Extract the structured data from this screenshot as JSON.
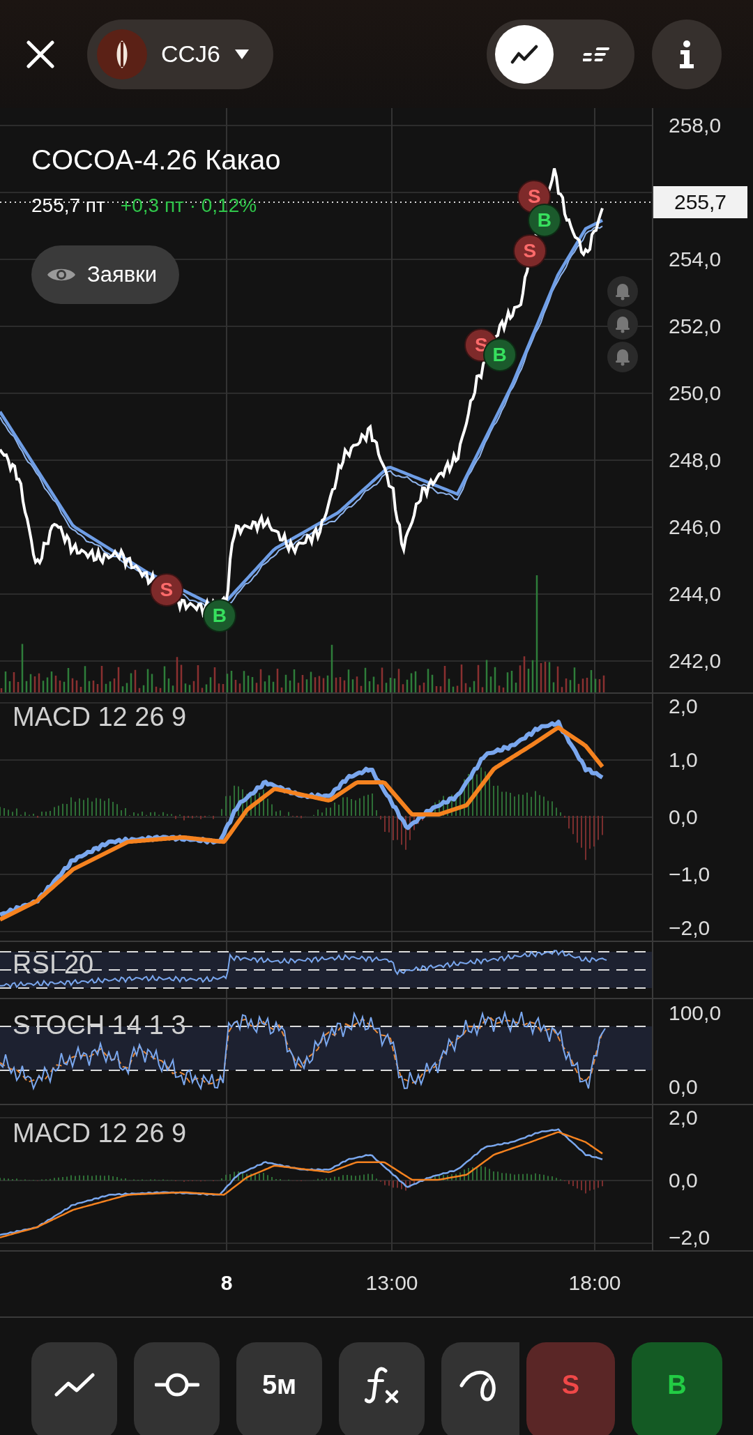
{
  "ticker": {
    "symbol": "CCJ6"
  },
  "view_toggle": [
    {
      "kind": "line",
      "selected": true
    },
    {
      "kind": "orders",
      "selected": false
    }
  ],
  "instrument": {
    "title": "COCOA-4.26 Какао",
    "price": "255,7 пт",
    "change": "+0,3 пт · 0,12%"
  },
  "orders_button": {
    "label": "Заявки"
  },
  "price_axis": [
    "258,0",
    "254,0",
    "252,0",
    "250,0",
    "248,0",
    "246,0",
    "244,0",
    "242,0"
  ],
  "current_price_tag": "255,7",
  "markers": [
    {
      "kind": "sell",
      "label": "S"
    },
    {
      "kind": "buy",
      "label": "B"
    },
    {
      "kind": "sell",
      "label": "S"
    },
    {
      "kind": "buy",
      "label": "B"
    },
    {
      "kind": "sell",
      "label": "S"
    },
    {
      "kind": "sell",
      "label": "S"
    },
    {
      "kind": "buy",
      "label": "B"
    }
  ],
  "panels": [
    {
      "kind": "macd",
      "label": "MACD 12 26 9",
      "ticks": [
        "2,0",
        "1,0",
        "0,0",
        "−1,0",
        "−2,0"
      ]
    },
    {
      "kind": "rsi",
      "label": "RSI 20"
    },
    {
      "kind": "stoch",
      "label": "STOCH 14 1 3",
      "ticks": [
        "100,0",
        "0,0"
      ]
    },
    {
      "kind": "macd_small",
      "label": "MACD 12 26 9",
      "ticks": [
        "2,0",
        "0,0",
        "−2,0"
      ]
    }
  ],
  "time_axis": [
    {
      "label": "8",
      "bold": true
    },
    {
      "label": "13:00",
      "bold": false
    },
    {
      "label": "18:00",
      "bold": false
    }
  ],
  "toolbar": [
    {
      "kind": "chart_type"
    },
    {
      "kind": "indicator"
    },
    {
      "kind": "interval",
      "label": "5м"
    },
    {
      "kind": "functions"
    },
    {
      "kind": "drawing"
    },
    {
      "kind": "sell",
      "label": "S"
    },
    {
      "kind": "buy",
      "label": "B"
    }
  ]
}
